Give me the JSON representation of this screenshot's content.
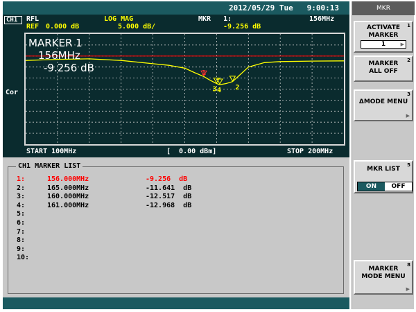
{
  "header": {
    "datetime": "2012/05/29 Tue   9:00:13",
    "channel": "CH1",
    "format": "RFL",
    "mode": "LOG MAG",
    "ref": "REF",
    "ref_value": "0.000 dB",
    "scale": "5.000 dB/",
    "mkr_label": "MKR   1:",
    "mkr_value": "-9.256 dB",
    "mkr_freq": "156MHz"
  },
  "plot": {
    "marker_title": "MARKER  1",
    "marker_freq": "156MHz",
    "marker_level": "-9.256 dB",
    "cor_label": "Cor",
    "start": "START 100MHz",
    "power": "[  0.00 dBm]",
    "stop": "STOP 200MHz",
    "trace_color": "#ffff00",
    "ref_line_color": "#ff0000",
    "marker_labels": [
      "1",
      "2",
      "3",
      "4"
    ]
  },
  "chart_data": {
    "type": "line",
    "xlabel": "",
    "ylabel": "",
    "xlim": [
      100,
      200
    ],
    "ylim": [
      -40,
      10
    ],
    "x": [
      100,
      110,
      120,
      130,
      140,
      145,
      150,
      153,
      156,
      158,
      160,
      161,
      163,
      165,
      167,
      170,
      175,
      180,
      190,
      200
    ],
    "series": [
      {
        "values": [
          -2.0,
          -1.5,
          -1.3,
          -2.0,
          -3.5,
          -4.2,
          -5.5,
          -7.5,
          -9.3,
          -11.0,
          -12.5,
          -13.0,
          -12.5,
          -11.6,
          -9.0,
          -5.0,
          -3.0,
          -2.5,
          -2.3,
          -2.2
        ]
      }
    ],
    "markers": [
      {
        "id": "1",
        "x": 156,
        "y": -9.256
      },
      {
        "id": "2",
        "x": 165,
        "y": -11.641
      },
      {
        "id": "3",
        "x": 160,
        "y": -12.517
      },
      {
        "id": "4",
        "x": 161,
        "y": -12.968
      }
    ]
  },
  "marker_list": {
    "title": "CH1 MARKER LIST",
    "rows": [
      {
        "num": "1:",
        "freq": "156.000MHz",
        "value": "-9.256  dB"
      },
      {
        "num": "2:",
        "freq": "165.000MHz",
        "value": "-11.641  dB"
      },
      {
        "num": "3:",
        "freq": "160.000MHz",
        "value": "-12.517  dB"
      },
      {
        "num": "4:",
        "freq": "161.000MHz",
        "value": "-12.968  dB"
      },
      {
        "num": "5:",
        "freq": "",
        "value": ""
      },
      {
        "num": "6:",
        "freq": "",
        "value": ""
      },
      {
        "num": "7:",
        "freq": "",
        "value": ""
      },
      {
        "num": "8:",
        "freq": "",
        "value": ""
      },
      {
        "num": "9:",
        "freq": "",
        "value": ""
      },
      {
        "num": "10:",
        "freq": "",
        "value": ""
      }
    ]
  },
  "softkeys": {
    "title": "MKR",
    "activate_line1": "ACTIVATE",
    "activate_line2": "MARKER",
    "activate_value": "1",
    "marker_all_off_line1": "MARKER",
    "marker_all_off_line2": "ALL OFF",
    "delta_mode": "ΔMODE MENU",
    "mkr_list": "MKR LIST",
    "on": "ON",
    "off": "OFF",
    "marker_mode_line1": "MARKER",
    "marker_mode_line2": "MODE MENU",
    "key_numbers": [
      "1",
      "2",
      "3",
      "5",
      "8"
    ]
  }
}
